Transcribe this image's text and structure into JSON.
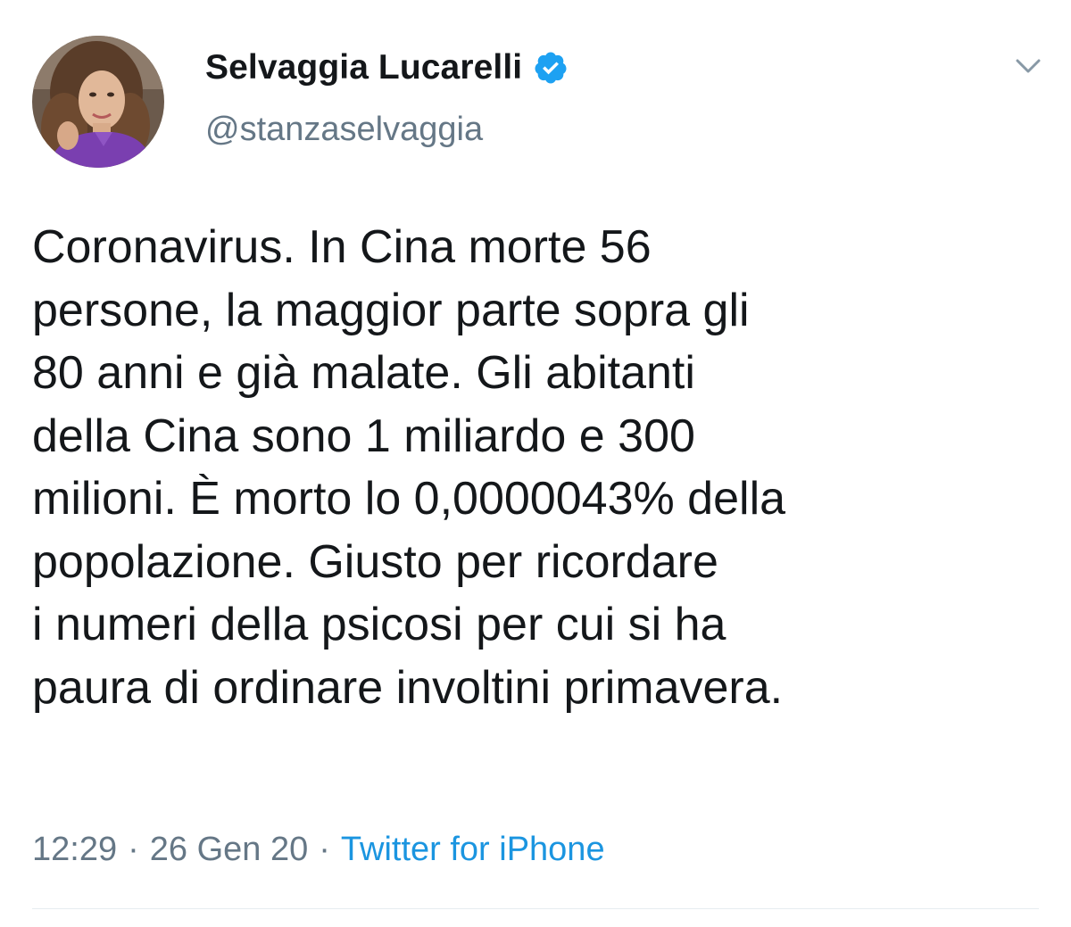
{
  "tweet": {
    "author": {
      "name": "Selvaggia Lucarelli",
      "handle": "@stanzaselvaggia",
      "verified": true,
      "avatar": "profile-photo"
    },
    "text": "Coronavirus. In Cina morte 56\npersone, la maggior parte sopra gli\n80 anni e già malate. Gli abitanti\ndella Cina sono 1 miliardo e 300\nmilioni. È morto lo 0,0000043% della\npopolazione. Giusto per ricordare\ni numeri della psicosi per cui si ha\npaura di ordinare involtini primavera.",
    "time": "12:29",
    "separator": "·",
    "date": "26 Gen 20",
    "source": "Twitter for iPhone"
  },
  "icons": {
    "verified": "verified-badge-icon",
    "menu": "chevron-down-icon"
  },
  "colors": {
    "text": "#14171a",
    "secondary": "#657786",
    "accent": "#1da1f2",
    "link": "#1b95e0",
    "divider": "#e6ecf0"
  }
}
